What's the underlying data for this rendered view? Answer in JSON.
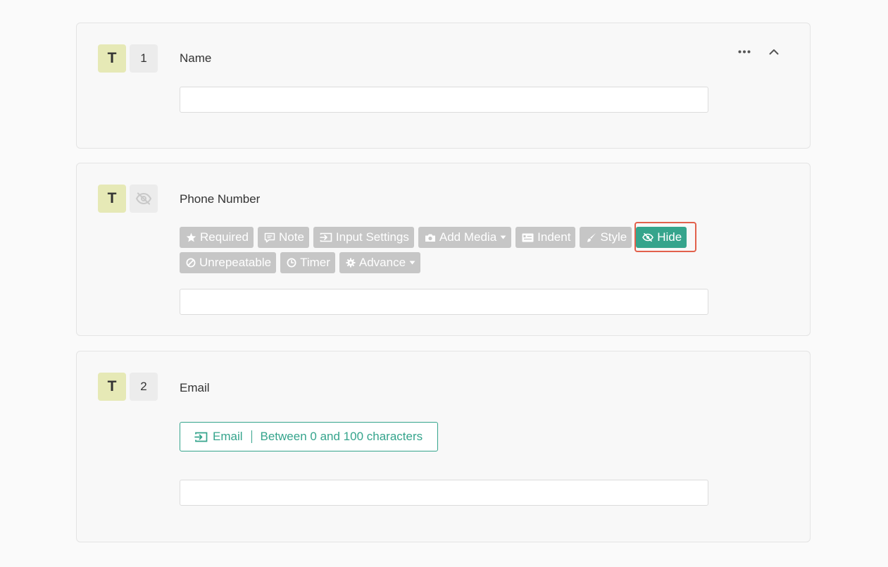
{
  "questions": [
    {
      "type_badge": "T",
      "number": "1",
      "title": "Name",
      "input_value": "",
      "actions": {
        "more_icon": "ellipsis-horizontal-icon",
        "collapse_icon": "chevron-up-icon"
      }
    },
    {
      "type_badge": "T",
      "number_icon": "eye-slash-icon",
      "title": "Phone Number",
      "input_value": "",
      "toolbar_row1": [
        {
          "label": "Required",
          "icon": "star-icon"
        },
        {
          "label": "Note",
          "icon": "comment-icon"
        },
        {
          "label": "Input Settings",
          "icon": "input-arrow-icon"
        },
        {
          "label": "Add Media",
          "icon": "camera-icon",
          "dropdown": true
        },
        {
          "label": "Indent",
          "icon": "indent-icon"
        },
        {
          "label": "Style",
          "icon": "brush-icon"
        },
        {
          "label": "Hide",
          "icon": "eye-slash-icon",
          "active": true
        }
      ],
      "toolbar_row2": [
        {
          "label": "Unrepeatable",
          "icon": "ban-icon"
        },
        {
          "label": "Timer",
          "icon": "clock-icon"
        },
        {
          "label": "Advance",
          "icon": "gear-icon",
          "dropdown": true
        }
      ]
    },
    {
      "type_badge": "T",
      "number": "2",
      "title": "Email",
      "input_value": "",
      "validation_chip": {
        "icon": "input-arrow-icon",
        "type_label": "Email",
        "rule_label": "Between 0 and 100 characters"
      }
    }
  ],
  "colors": {
    "accent_green": "#35a48c",
    "badge_yellow": "#e6e9b6",
    "toolbar_gray": "#c6c6c6",
    "highlight_red": "#e2614c"
  }
}
